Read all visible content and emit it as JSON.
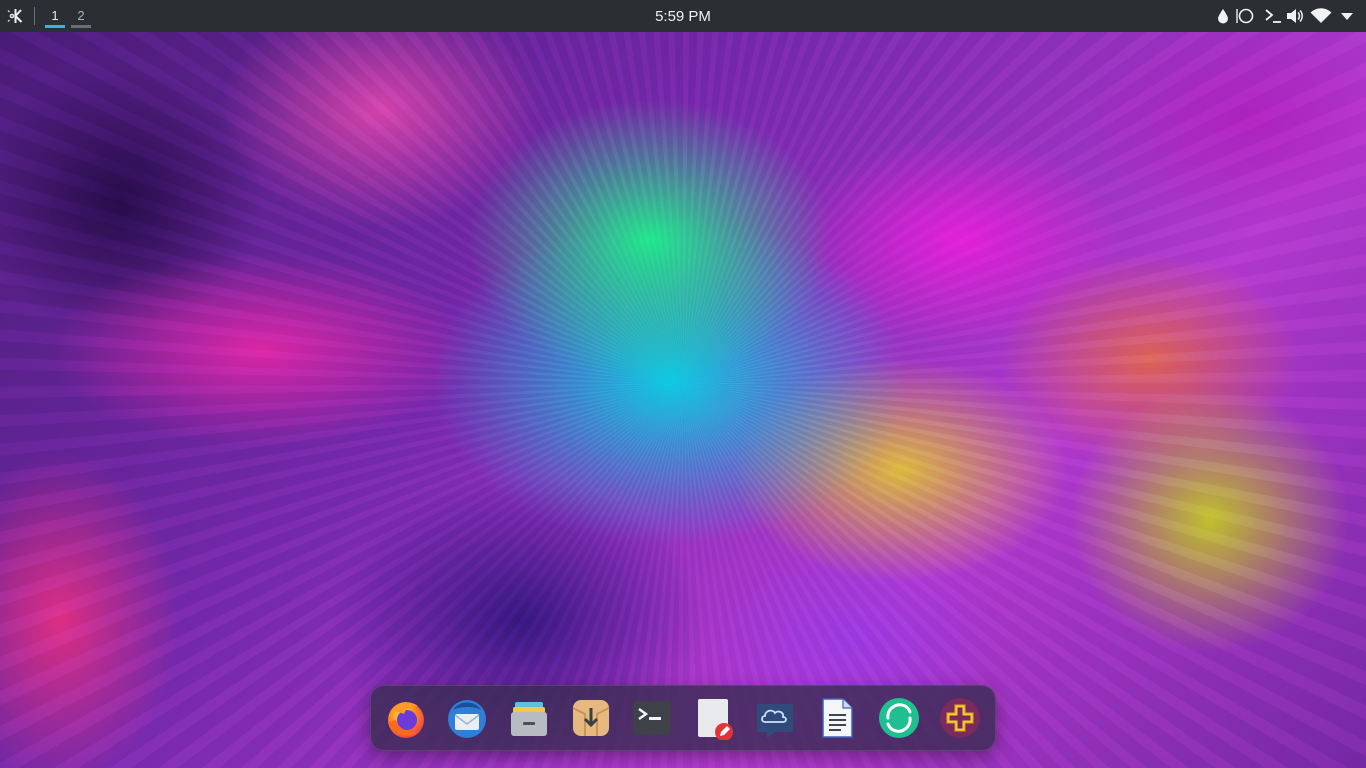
{
  "panel": {
    "launcher_icon": "kde-logo-icon",
    "pager": [
      {
        "label": "1",
        "active": true
      },
      {
        "label": "2",
        "active": false
      }
    ],
    "clock": "5:59 PM",
    "tray_icons": [
      "color-picker-icon",
      "circle-icon",
      "terminal-icon",
      "volume-icon",
      "wifi-icon",
      "chevron-down-icon"
    ]
  },
  "dock": {
    "apps": [
      {
        "name": "firefox-icon"
      },
      {
        "name": "thunderbird-icon"
      },
      {
        "name": "archive-manager-icon"
      },
      {
        "name": "software-installer-icon"
      },
      {
        "name": "terminal-icon"
      },
      {
        "name": "text-editor-icon"
      },
      {
        "name": "cloud-storage-icon"
      },
      {
        "name": "writer-document-icon"
      },
      {
        "name": "element-chat-icon"
      },
      {
        "name": "add-app-icon"
      }
    ]
  },
  "colors": {
    "panel_bg": "#2b2e33",
    "active_desktop": "#3daee9",
    "dock_bg": "#3a2c54"
  }
}
